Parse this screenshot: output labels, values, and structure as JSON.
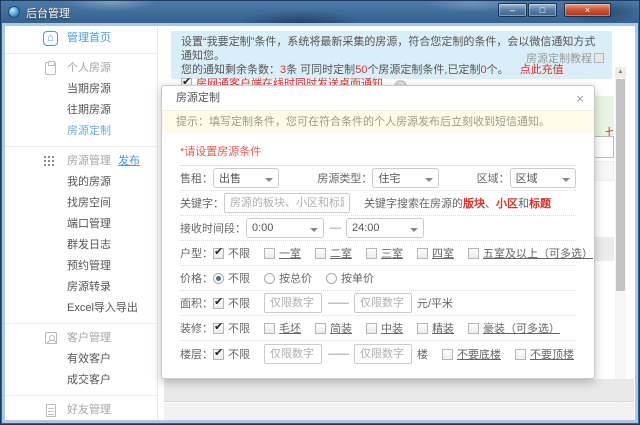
{
  "colors": {
    "accent_red": "#d9342b",
    "link_blue": "#4a9ad6",
    "active_blue": "#6cacde",
    "banner_bg": "#d9eef8"
  },
  "icons": {
    "check": "✔",
    "home": "⌂",
    "help": "?",
    "scroll_up": "▲",
    "min": "–",
    "max": "□",
    "close": "×",
    "modal_close": "×"
  },
  "window": {
    "title": "后台管理"
  },
  "sidebar": {
    "items": [
      {
        "label": "管理首页"
      },
      {
        "label": "个人房源"
      },
      {
        "label": "当期房源"
      },
      {
        "label": "往期房源"
      },
      {
        "label": "房源定制"
      },
      {
        "label": "房源管理",
        "link": "发布"
      },
      {
        "label": "我的房源"
      },
      {
        "label": "找房空间"
      },
      {
        "label": "端口管理"
      },
      {
        "label": "群发日志"
      },
      {
        "label": "预约管理"
      },
      {
        "label": "房源转录"
      },
      {
        "label": "Excel导入导出"
      },
      {
        "label": "客户管理"
      },
      {
        "label": "有效客户"
      },
      {
        "label": "成交客户"
      },
      {
        "label": "好友管理"
      }
    ]
  },
  "banner": {
    "line1": "设置“我要定制”条件，系统将最新采集的房源，符合您定制的条件，会以微信通知方式通知您。",
    "line2": {
      "t1": "您的通知剩余条数：",
      "n1": "3",
      "t2": "条 可同时定制",
      "n2": "50",
      "t3": "个房源定制条件,已定制",
      "n3": "0",
      "t4": "个。",
      "recharge": "点此充值"
    },
    "tutorial": "房源定制教程",
    "desktop_notice": "房网通客户端在线时同时发送桌面通知"
  },
  "modal": {
    "title": "房源定制",
    "hint": "提示：填写定制条件，您可在符合条件的个人房源发布后立刻收到短信通知。",
    "section_label": "*请设置房源条件",
    "sale_label": "售租：",
    "sale_value": "出售",
    "type_label": "房源类型：",
    "type_value": "住宅",
    "region_label": "区域：",
    "region_value": "区域",
    "keyword_label": "关键字：",
    "keyword_placeholder": "房源的板块、小区和标题",
    "keyword_help": {
      "prefix": "关键字搜索在房源的",
      "hl1": "版块",
      "sep1": "、",
      "hl2": "小区",
      "sep2": "和",
      "hl3": "标题"
    },
    "time_label": "接收时间段：",
    "time_from": "0:00",
    "time_dash": "—",
    "time_to": "24:00",
    "unlimited": "不限",
    "layout_label": "户型：",
    "layout_options": [
      "一室",
      "二室",
      "三室",
      "四室",
      "五室及以上（可多选）"
    ],
    "price_label": "价格：",
    "price_opt1": "不限",
    "price_opt2": "按总价",
    "price_opt3": "按单价",
    "area_label": "面积：",
    "num_placeholder": "仅限数字",
    "range_dash": "——",
    "area_unit": "元/平米",
    "deco_label": "装修：",
    "deco_options": [
      "毛坯",
      "简装",
      "中装",
      "精装",
      "豪装（可多选）"
    ],
    "floor_label": "楼层：",
    "floor_unit": "楼",
    "floor_opt1": "不要底楼",
    "floor_opt2": "不要顶楼"
  }
}
